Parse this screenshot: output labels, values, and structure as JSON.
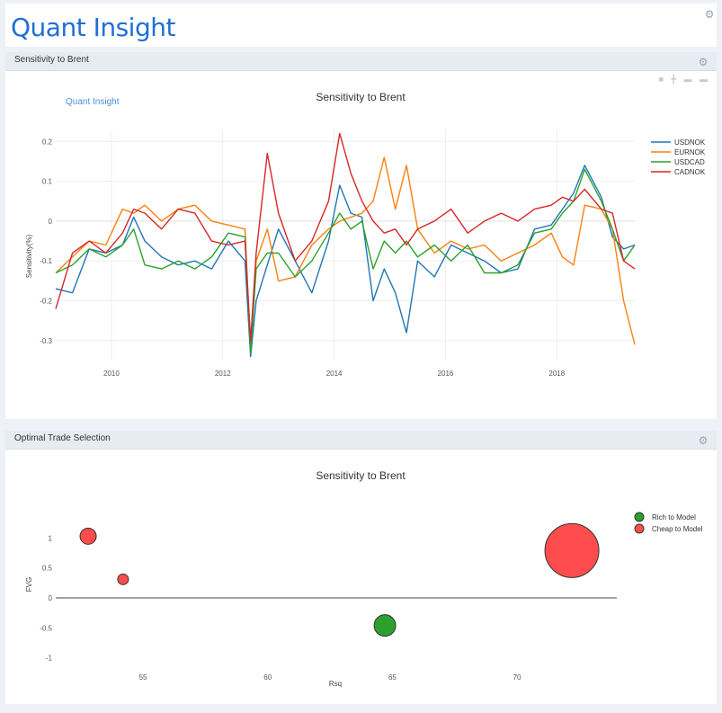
{
  "app": {
    "brand": "Quant Insight"
  },
  "panels": {
    "sensitivity": {
      "title": "Sensitivity to Brent"
    },
    "trade": {
      "title": "Optimal Trade Selection"
    }
  },
  "icons": {
    "settings": "gear-icon",
    "camera": "camera-icon",
    "zoom": "zoom-icon",
    "pan": "pan-icon",
    "reset": "reset-icon"
  },
  "colors": {
    "brand": "#1f6fd6",
    "USDNOK": "#1f77b4",
    "EURNOK": "#ff7f0e",
    "USDCAD": "#2ca02c",
    "CADNOK": "#d62728"
  },
  "chart_data": [
    {
      "type": "line",
      "title": "Sensitivity to Brent",
      "watermark": "Quant Insight",
      "xlabel": "",
      "ylabel": "Sensitivity(%)",
      "xlim": [
        2009.0,
        2019.4
      ],
      "ylim": [
        -0.35,
        0.23
      ],
      "xticks": [
        2010,
        2012,
        2014,
        2016,
        2018
      ],
      "yticks": [
        -0.3,
        -0.2,
        -0.1,
        0,
        0.1,
        0.2
      ],
      "legend": "top-right",
      "grid": true,
      "series": [
        {
          "name": "USDNOK",
          "color": "#1f77b4",
          "x": [
            2009.0,
            2009.3,
            2009.6,
            2009.9,
            2010.2,
            2010.4,
            2010.6,
            2010.9,
            2011.2,
            2011.5,
            2011.8,
            2012.1,
            2012.4,
            2012.5,
            2012.6,
            2012.8,
            2013.0,
            2013.3,
            2013.6,
            2013.9,
            2014.1,
            2014.3,
            2014.5,
            2014.7,
            2014.9,
            2015.1,
            2015.3,
            2015.5,
            2015.8,
            2016.1,
            2016.4,
            2016.7,
            2017.0,
            2017.3,
            2017.6,
            2017.9,
            2018.1,
            2018.3,
            2018.5,
            2018.8,
            2019.0,
            2019.2,
            2019.4
          ],
          "y": [
            -0.17,
            -0.18,
            -0.07,
            -0.08,
            -0.06,
            0.01,
            -0.05,
            -0.09,
            -0.11,
            -0.1,
            -0.12,
            -0.05,
            -0.1,
            -0.34,
            -0.2,
            -0.11,
            -0.02,
            -0.1,
            -0.18,
            -0.05,
            0.09,
            0.02,
            0.01,
            -0.2,
            -0.12,
            -0.18,
            -0.28,
            -0.1,
            -0.14,
            -0.06,
            -0.08,
            -0.1,
            -0.13,
            -0.12,
            -0.02,
            -0.01,
            0.03,
            0.07,
            0.14,
            0.06,
            -0.04,
            -0.07,
            -0.06
          ]
        },
        {
          "name": "EURNOK",
          "color": "#ff7f0e",
          "x": [
            2009.0,
            2009.3,
            2009.6,
            2009.9,
            2010.2,
            2010.4,
            2010.6,
            2010.9,
            2011.2,
            2011.5,
            2011.8,
            2012.1,
            2012.4,
            2012.5,
            2012.6,
            2012.8,
            2013.0,
            2013.3,
            2013.6,
            2013.9,
            2014.1,
            2014.3,
            2014.5,
            2014.7,
            2014.9,
            2015.1,
            2015.3,
            2015.5,
            2015.8,
            2016.1,
            2016.4,
            2016.7,
            2017.0,
            2017.3,
            2017.6,
            2017.9,
            2018.1,
            2018.3,
            2018.5,
            2018.8,
            2019.0,
            2019.2,
            2019.4
          ],
          "y": [
            -0.13,
            -0.09,
            -0.05,
            -0.06,
            0.03,
            0.02,
            0.04,
            0.0,
            0.03,
            0.04,
            0.0,
            -0.01,
            -0.02,
            -0.32,
            -0.1,
            -0.02,
            -0.15,
            -0.14,
            -0.06,
            -0.02,
            0.0,
            0.01,
            0.02,
            0.05,
            0.16,
            0.03,
            0.14,
            -0.02,
            -0.08,
            -0.05,
            -0.07,
            -0.06,
            -0.1,
            -0.08,
            -0.06,
            -0.03,
            -0.09,
            -0.11,
            0.04,
            0.03,
            -0.02,
            -0.2,
            -0.31
          ]
        },
        {
          "name": "USDCAD",
          "color": "#2ca02c",
          "x": [
            2009.0,
            2009.3,
            2009.6,
            2009.9,
            2010.2,
            2010.4,
            2010.6,
            2010.9,
            2011.2,
            2011.5,
            2011.8,
            2012.1,
            2012.4,
            2012.5,
            2012.6,
            2012.8,
            2013.0,
            2013.3,
            2013.6,
            2013.9,
            2014.1,
            2014.3,
            2014.5,
            2014.7,
            2014.9,
            2015.1,
            2015.3,
            2015.5,
            2015.8,
            2016.1,
            2016.4,
            2016.7,
            2017.0,
            2017.3,
            2017.6,
            2017.9,
            2018.1,
            2018.3,
            2018.5,
            2018.8,
            2019.0,
            2019.2,
            2019.4
          ],
          "y": [
            -0.13,
            -0.11,
            -0.07,
            -0.09,
            -0.06,
            -0.02,
            -0.11,
            -0.12,
            -0.1,
            -0.12,
            -0.09,
            -0.03,
            -0.04,
            -0.33,
            -0.12,
            -0.08,
            -0.08,
            -0.14,
            -0.1,
            -0.03,
            0.02,
            -0.02,
            0.0,
            -0.12,
            -0.05,
            -0.08,
            -0.05,
            -0.09,
            -0.06,
            -0.1,
            -0.06,
            -0.13,
            -0.13,
            -0.11,
            -0.03,
            -0.02,
            0.02,
            0.05,
            0.13,
            0.05,
            -0.02,
            -0.1,
            -0.06
          ]
        },
        {
          "name": "CADNOK",
          "color": "#d62728",
          "x": [
            2009.0,
            2009.3,
            2009.6,
            2009.9,
            2010.2,
            2010.4,
            2010.6,
            2010.9,
            2011.2,
            2011.5,
            2011.8,
            2012.1,
            2012.4,
            2012.5,
            2012.6,
            2012.8,
            2013.0,
            2013.3,
            2013.6,
            2013.9,
            2014.1,
            2014.3,
            2014.5,
            2014.7,
            2014.9,
            2015.1,
            2015.3,
            2015.5,
            2015.8,
            2016.1,
            2016.4,
            2016.7,
            2017.0,
            2017.3,
            2017.6,
            2017.9,
            2018.1,
            2018.3,
            2018.5,
            2018.8,
            2019.0,
            2019.2,
            2019.4
          ],
          "y": [
            -0.22,
            -0.08,
            -0.05,
            -0.08,
            -0.03,
            0.03,
            0.02,
            -0.02,
            0.03,
            0.02,
            -0.05,
            -0.06,
            -0.05,
            -0.3,
            -0.08,
            0.17,
            0.02,
            -0.1,
            -0.05,
            0.05,
            0.22,
            0.12,
            0.05,
            0.0,
            -0.03,
            -0.02,
            -0.06,
            -0.02,
            0.0,
            0.03,
            -0.03,
            0.0,
            0.02,
            0.0,
            0.03,
            0.04,
            0.06,
            0.05,
            0.08,
            0.03,
            0.02,
            -0.1,
            -0.12
          ]
        }
      ]
    },
    {
      "type": "scatter",
      "title": "Sensitivity to Brent",
      "xlabel": "Rsq",
      "ylabel": "FVG",
      "xlim": [
        51.5,
        74.0
      ],
      "ylim": [
        -1.2,
        1.35
      ],
      "xticks": [
        55,
        60,
        65,
        70
      ],
      "yticks": [
        -1,
        -0.5,
        0,
        0.5,
        1
      ],
      "legend": "top-right",
      "series": [
        {
          "name": "Rich to Model",
          "color": "#2ca02c",
          "points": [
            {
              "x": 64.7,
              "y": -0.46,
              "size": 12
            }
          ]
        },
        {
          "name": "Cheap to Model",
          "color": "#ff4d4d",
          "points": [
            {
              "x": 52.8,
              "y": 1.03,
              "size": 9
            },
            {
              "x": 54.2,
              "y": 0.31,
              "size": 6
            },
            {
              "x": 72.2,
              "y": 0.79,
              "size": 30
            }
          ]
        }
      ]
    }
  ]
}
